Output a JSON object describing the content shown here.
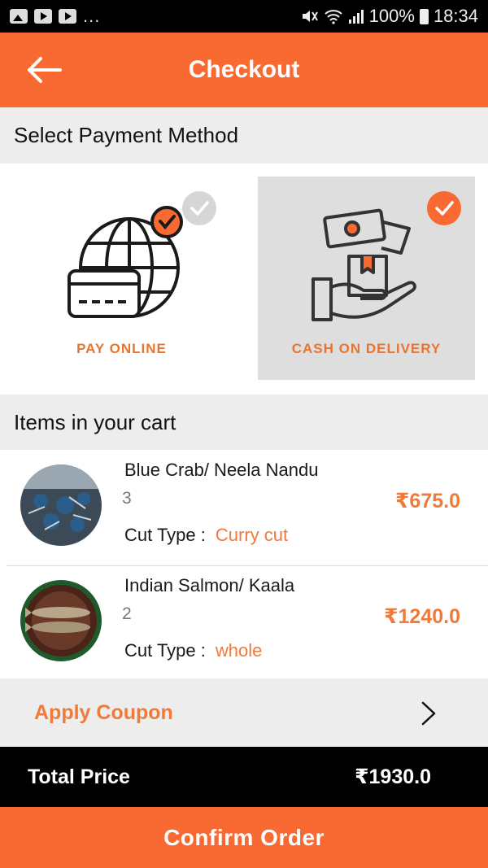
{
  "status_bar": {
    "left_icons": [
      "gallery-icon",
      "youtube-icon",
      "youtube-icon"
    ],
    "dots": "...",
    "battery": "100%",
    "time": "18:34"
  },
  "header": {
    "title": "Checkout",
    "back_icon": "back-arrow-icon",
    "color": "#f96a33"
  },
  "payment": {
    "section_title": "Select Payment Method",
    "options": [
      {
        "label": "PAY ONLINE",
        "icon": "globe-card-icon",
        "selected": false
      },
      {
        "label": "CASH ON DELIVERY",
        "icon": "cash-hand-icon",
        "selected": true
      }
    ]
  },
  "cart": {
    "section_title": "Items in your cart",
    "items": [
      {
        "name": "Blue Crab/ Neela Nandu",
        "qty": "3",
        "cut_label": "Cut Type :",
        "cut_value": "Curry cut",
        "price": "₹675.0"
      },
      {
        "name": "Indian Salmon/ Kaala",
        "qty": "2",
        "cut_label": "Cut Type :",
        "cut_value": "whole",
        "price": "₹1240.0"
      }
    ]
  },
  "coupon": {
    "label": "Apply Coupon"
  },
  "total": {
    "label": "Total Price",
    "value": "₹1930.0"
  },
  "confirm": {
    "label": "Confirm Order"
  },
  "colors": {
    "accent": "#f96a33",
    "accent_text": "#f07a3a",
    "section_bg": "#ededed"
  }
}
